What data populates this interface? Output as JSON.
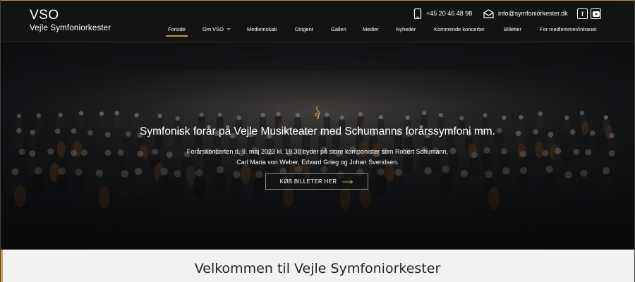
{
  "header": {
    "logo_abbr": "VSO",
    "logo_name": "Vejle Symfoniorkester",
    "phone": "+45 20 46 48 98",
    "email": "info@symfoniorkester.dk",
    "social": [
      {
        "icon": "facebook-icon",
        "glyph": "f"
      },
      {
        "icon": "youtube-icon",
        "glyph": "▶"
      }
    ]
  },
  "nav": {
    "items": [
      {
        "label": "Forside",
        "active": true
      },
      {
        "label": "Om VSO",
        "dropdown": true
      },
      {
        "label": "Medlemskab"
      },
      {
        "label": "Dirigent"
      },
      {
        "label": "Galleri"
      },
      {
        "label": "Medier"
      },
      {
        "label": "Nyheder"
      },
      {
        "label": "Kommende koncerter"
      },
      {
        "label": "Billetter"
      },
      {
        "label": "For medlemmer/Intranet"
      }
    ]
  },
  "hero": {
    "icon": "treble-clef-icon",
    "title": "Symfonisk forår på Vejle Musikteater med Schumanns forårssymfoni mm.",
    "text_line1": "Forårskoncerten d. 9. maj 2023 kl. 19.30 byder på store komponister som Robert Schumann,",
    "text_line2": "Carl Maria von Weber, Edvard Grieg og Johan Svendsen.",
    "cta_label": "KØB BILLETER HER"
  },
  "welcome": {
    "title": "Velkommen til Vejle Symfoniorkester"
  },
  "colors": {
    "accent": "#c89a3c",
    "header_bg": "#131313",
    "welcome_bar": "#d89b45"
  }
}
